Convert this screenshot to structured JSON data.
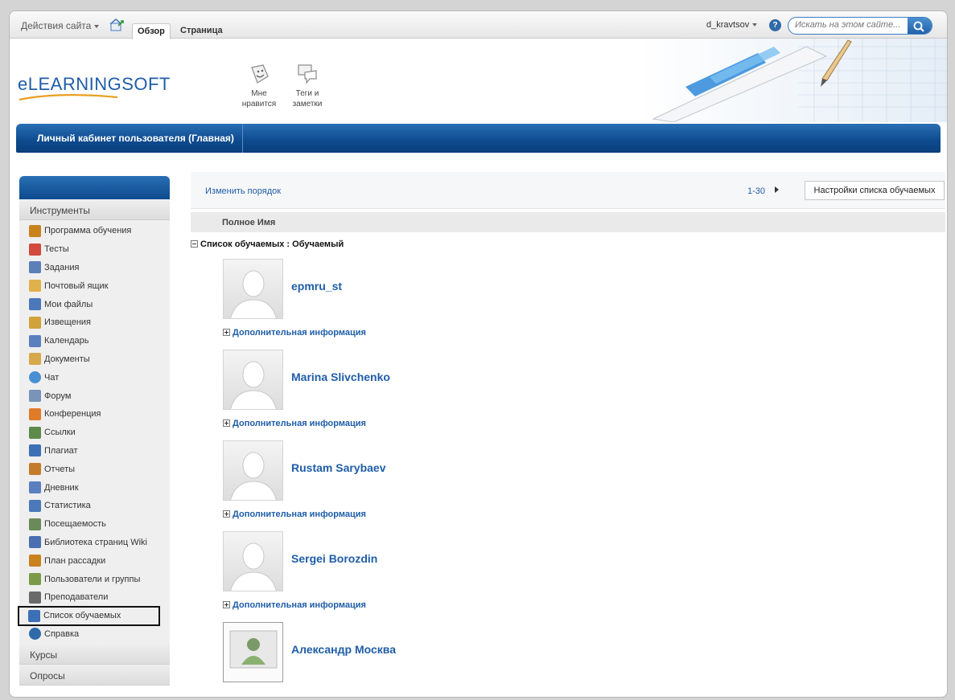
{
  "ribbon": {
    "site_actions": "Действия сайта",
    "tabs": [
      "Обзор",
      "Страница"
    ],
    "user": "d_kravtsov",
    "help": "?",
    "search_placeholder": "Искать на этом сайте..."
  },
  "header": {
    "logo": "eLEARNINGSOFT",
    "like_label_1": "Мне",
    "like_label_2": "нравится",
    "tags_label_1": "Теги и",
    "tags_label_2": "заметки"
  },
  "topnav": {
    "title": "Личный кабинет пользователя (Главная)"
  },
  "sidebar": {
    "tools_heading": "Инструменты",
    "items": [
      {
        "label": "Программа обучения",
        "icon": "program-icon",
        "color": "#c9831e"
      },
      {
        "label": "Тесты",
        "icon": "tests-icon",
        "color": "#d24a3c"
      },
      {
        "label": "Задания",
        "icon": "tasks-icon",
        "color": "#5c7fb8"
      },
      {
        "label": "Почтовый ящик",
        "icon": "mailbox-icon",
        "color": "#e0b04a"
      },
      {
        "label": "Мои файлы",
        "icon": "files-icon",
        "color": "#4a78b8"
      },
      {
        "label": "Извещения",
        "icon": "announcements-icon",
        "color": "#d1a23a"
      },
      {
        "label": "Календарь",
        "icon": "calendar-icon",
        "color": "#5a7fbf"
      },
      {
        "label": "Документы",
        "icon": "documents-icon",
        "color": "#d6a84a"
      },
      {
        "label": "Чат",
        "icon": "chat-icon",
        "color": "#4a8fd2"
      },
      {
        "label": "Форум",
        "icon": "forum-icon",
        "color": "#7a93b8"
      },
      {
        "label": "Конференция",
        "icon": "conference-icon",
        "color": "#e07b2a"
      },
      {
        "label": "Ссылки",
        "icon": "links-icon",
        "color": "#5d8a4a"
      },
      {
        "label": "Плагиат",
        "icon": "plagiarism-icon",
        "color": "#3c6fb4"
      },
      {
        "label": "Отчеты",
        "icon": "reports-icon",
        "color": "#c47c2a"
      },
      {
        "label": "Дневник",
        "icon": "diary-icon",
        "color": "#5a7fbf"
      },
      {
        "label": "Статистика",
        "icon": "statistics-icon",
        "color": "#4a78b8"
      },
      {
        "label": "Посещаемость",
        "icon": "attendance-icon",
        "color": "#6b8a5a"
      },
      {
        "label": "Библиотека страниц Wiki",
        "icon": "wiki-icon",
        "color": "#4a6fb0"
      },
      {
        "label": "План рассадки",
        "icon": "seating-icon",
        "color": "#c9831e"
      },
      {
        "label": "Пользователи и группы",
        "icon": "users-groups-icon",
        "color": "#7a9a4a"
      },
      {
        "label": "Преподаватели",
        "icon": "teachers-icon",
        "color": "#6a6a6a"
      },
      {
        "label": "Список обучаемых",
        "icon": "learners-icon",
        "color": "#3c6fb4"
      },
      {
        "label": "Справка",
        "icon": "help-icon",
        "color": "#2f6aa8"
      }
    ],
    "courses_heading": "Курсы",
    "surveys_heading": "Опросы"
  },
  "main": {
    "reorder": "Изменить порядок",
    "pager": "1-30",
    "settings": "Настройки списка обучаемых",
    "column": "Полное Имя",
    "group": "Список обучаемых : Обучаемый",
    "more_info": "Дополнительная информация",
    "learners": [
      {
        "name": "epmru_st"
      },
      {
        "name": "Marina Slivchenko"
      },
      {
        "name": "Rustam Sarybaev"
      },
      {
        "name": "Sergei Borozdin"
      },
      {
        "name": "Александр Москва"
      }
    ]
  }
}
